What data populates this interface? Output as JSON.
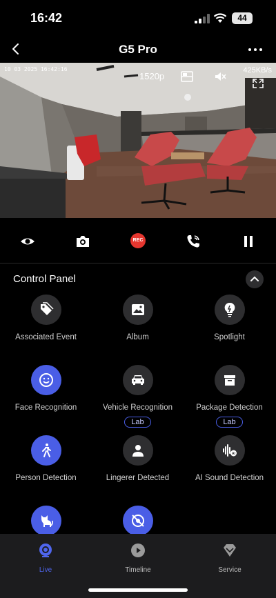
{
  "status_bar": {
    "time": "16:42",
    "battery": "44"
  },
  "nav": {
    "title": "G5 Pro"
  },
  "video": {
    "timestamp": "10 03 2025 16:42:16",
    "resolution": "1520p",
    "bitrate": "425KB/s"
  },
  "control_panel": {
    "title": "Control Panel",
    "items": [
      {
        "label": "Associated Event",
        "icon": "tags-icon",
        "active": false
      },
      {
        "label": "Album",
        "icon": "image-icon",
        "active": false
      },
      {
        "label": "Spotlight",
        "icon": "lightbulb-icon",
        "active": false
      },
      {
        "label": "Face Recognition",
        "icon": "smiley-icon",
        "active": true
      },
      {
        "label": "Vehicle Recognition",
        "icon": "car-icon",
        "active": false,
        "badge": "Lab"
      },
      {
        "label": "Package Detection",
        "icon": "package-icon",
        "active": false,
        "badge": "Lab"
      },
      {
        "label": "Person Detection",
        "icon": "walking-person-icon",
        "active": true
      },
      {
        "label": "Lingerer Detected",
        "icon": "person-icon",
        "active": false
      },
      {
        "label": "AI Sound Detection",
        "icon": "sound-wave-icon",
        "active": false
      },
      {
        "label": "",
        "icon": "cat-icon",
        "active": true
      },
      {
        "label": "",
        "icon": "privacy-off-icon",
        "active": true
      }
    ]
  },
  "tabs": [
    {
      "label": "Live",
      "icon": "camera-lens-icon",
      "active": true
    },
    {
      "label": "Timeline",
      "icon": "play-circle-icon",
      "active": false
    },
    {
      "label": "Service",
      "icon": "diamond-icon",
      "active": false
    }
  ],
  "colors": {
    "accent": "#4a5ee6",
    "record": "#e5362f",
    "background": "#000000",
    "tabbar": "#1c1c1e"
  }
}
